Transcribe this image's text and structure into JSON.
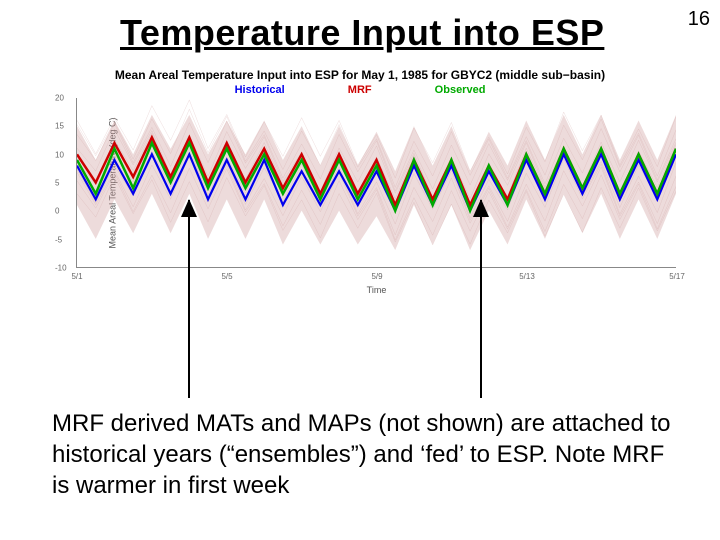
{
  "page_number": "16",
  "title": "Temperature Input into ESP",
  "caption": "MRF derived MATs and MAPs (not shown) are attached to historical years (“ensembles”) and ‘fed’ to ESP. Note MRF is warmer in first week",
  "chart_data": {
    "type": "line",
    "title": "Mean Areal Temperature Input into ESP for May 1, 1985 for GBYC2 (middle sub−basin)",
    "xlabel": "Time",
    "ylabel": "Mean Areal Temperature (deg C)",
    "ylim": [
      -10,
      20
    ],
    "yticks": [
      -10,
      -5,
      0,
      5,
      10,
      15,
      20
    ],
    "x_categories": [
      "5/1",
      "5/5",
      "5/9",
      "5/13",
      "5/17"
    ],
    "legend": [
      {
        "name": "Historical",
        "color": "#0000ee"
      },
      {
        "name": "MRF",
        "color": "#cc0000"
      },
      {
        "name": "Observed",
        "color": "#00aa00"
      }
    ],
    "series": [
      {
        "name": "Historical",
        "color": "#0000ee",
        "width": 2.2,
        "values": [
          8,
          2,
          9,
          3,
          10,
          3,
          10,
          2,
          9,
          2,
          9,
          1,
          7,
          1,
          7,
          1,
          7,
          0,
          8,
          1,
          8,
          0,
          7,
          1,
          9,
          2,
          10,
          3,
          10,
          2,
          9,
          2,
          10
        ]
      },
      {
        "name": "MRF",
        "color": "#cc0000",
        "width": 2.5,
        "values": [
          10,
          5,
          12,
          6,
          13,
          6,
          13,
          5,
          12,
          5,
          11,
          4,
          10,
          3,
          10,
          3,
          9,
          1,
          9,
          2,
          9,
          1,
          8,
          2,
          10,
          3,
          11,
          4,
          11,
          3,
          10,
          3,
          11
        ]
      },
      {
        "name": "Observed",
        "color": "#00aa00",
        "width": 2.5,
        "values": [
          9,
          3,
          11,
          4,
          12,
          5,
          12,
          4,
          11,
          4,
          10,
          3,
          9,
          2,
          9,
          2,
          8,
          0,
          9,
          1,
          9,
          0,
          8,
          1,
          10,
          3,
          11,
          4,
          11,
          3,
          10,
          3,
          11
        ]
      }
    ],
    "ensemble_band": {
      "color": "#cc9999",
      "opacity": 0.35,
      "upper": [
        15,
        9,
        16,
        10,
        17,
        11,
        17,
        10,
        16,
        10,
        16,
        9,
        15,
        8,
        15,
        8,
        14,
        7,
        15,
        8,
        15,
        7,
        14,
        8,
        16,
        9,
        17,
        10,
        17,
        9,
        16,
        9,
        17
      ],
      "lower": [
        1,
        -5,
        2,
        -4,
        3,
        -4,
        3,
        -5,
        2,
        -5,
        2,
        -6,
        0,
        -6,
        0,
        -6,
        -1,
        -7,
        1,
        -6,
        1,
        -7,
        0,
        -6,
        2,
        -5,
        3,
        -4,
        3,
        -5,
        2,
        -5,
        3
      ]
    }
  }
}
